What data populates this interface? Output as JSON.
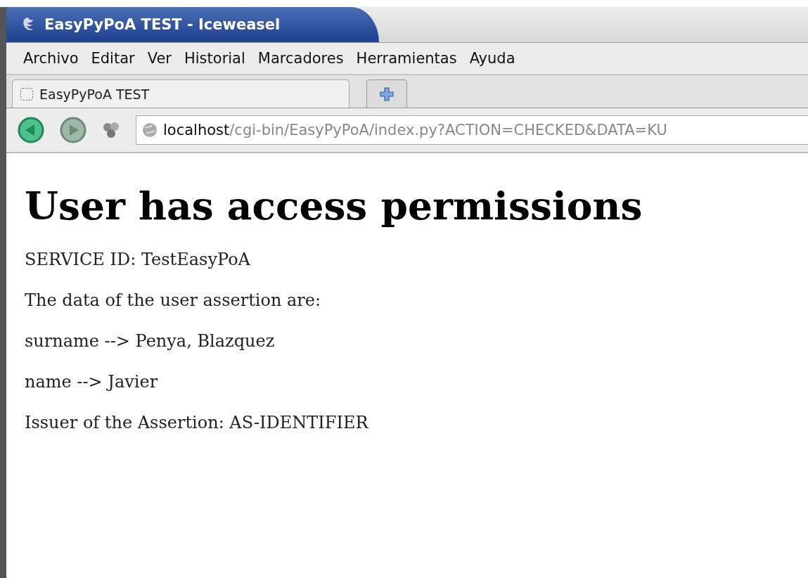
{
  "window": {
    "title": "EasyPyPoA TEST - Iceweasel"
  },
  "menu": [
    "Archivo",
    "Editar",
    "Ver",
    "Historial",
    "Marcadores",
    "Herramientas",
    "Ayuda"
  ],
  "tabs": [
    {
      "label": "EasyPyPoA TEST",
      "selected": true
    }
  ],
  "address": {
    "host": "localhost",
    "path": "/cgi-bin/EasyPyPoA/index.py?ACTION=CHECKED&DATA=KU"
  },
  "content": {
    "heading": "User has access permissions",
    "paragraphs": [
      "SERVICE ID: TestEasyPoA",
      "The data of the user assertion are:",
      "surname --> Penya, Blazquez",
      "name --> Javier",
      "Issuer of the Assertion: AS-IDENTIFIER"
    ]
  }
}
